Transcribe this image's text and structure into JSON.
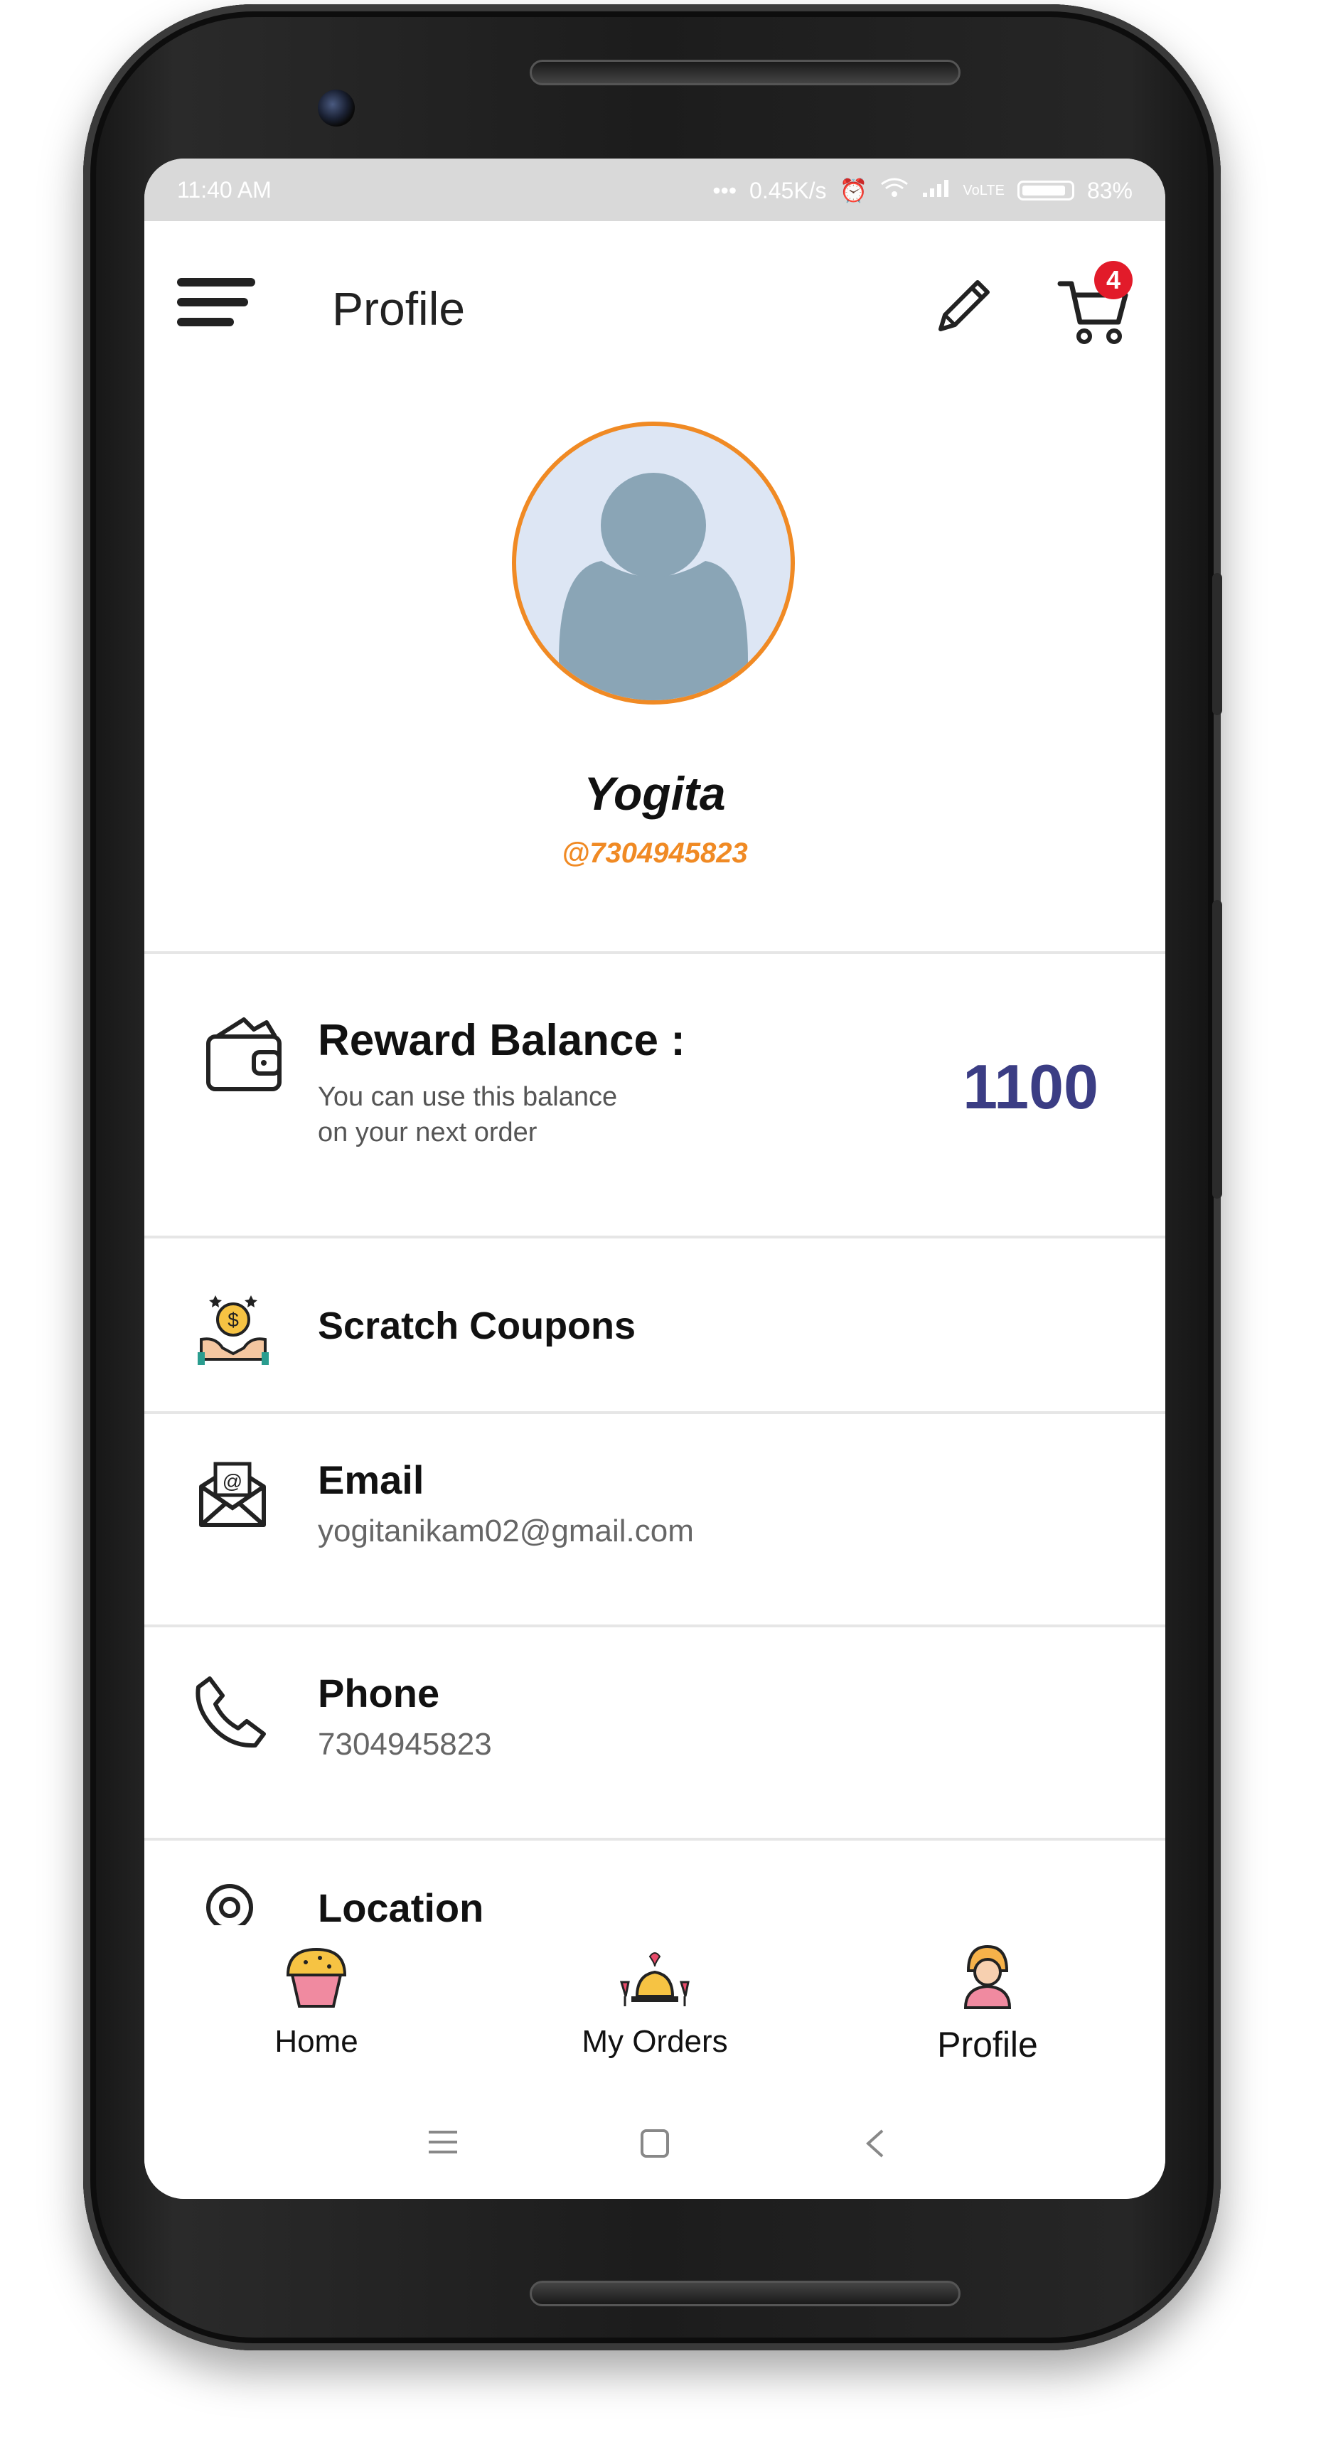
{
  "statusbar": {
    "time": "11:40 AM",
    "network_speed": "0.45K/s",
    "battery": "83%"
  },
  "appbar": {
    "title": "Profile",
    "cart_count": "4"
  },
  "profile": {
    "name": "Yogita",
    "handle": "@7304945823"
  },
  "reward": {
    "title": "Reward Balance :",
    "subtitle_line1": "You can use this balance",
    "subtitle_line2": "on your next order",
    "value": "1100"
  },
  "items": {
    "scratch": {
      "title": "Scratch Coupons"
    },
    "email": {
      "title": "Email",
      "value": "yogitanikam02@gmail.com"
    },
    "phone": {
      "title": "Phone",
      "value": "7304945823"
    },
    "location": {
      "title": "Location"
    }
  },
  "bottom_nav": {
    "home": "Home",
    "orders": "My Orders",
    "profile": "Profile"
  },
  "colors": {
    "accent": "#f08a24",
    "reward_value": "#3b3d84",
    "badge": "#e21b2a"
  }
}
